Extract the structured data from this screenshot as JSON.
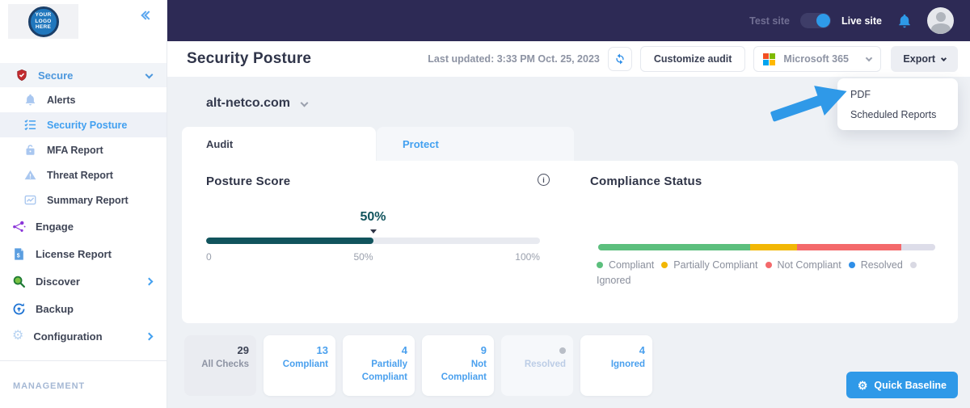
{
  "topbar": {
    "test_site": "Test site",
    "live_site": "Live site"
  },
  "sidebar": {
    "logo_lines": [
      "YOUR",
      "LOGO",
      "HERE"
    ],
    "secure_label": "Secure",
    "secure_items": [
      {
        "label": "Alerts",
        "icon": "bell-icon"
      },
      {
        "label": "Security Posture",
        "icon": "checklist-icon",
        "active": true
      },
      {
        "label": "MFA Report",
        "icon": "lock-icon"
      },
      {
        "label": "Threat Report",
        "icon": "warning-icon"
      },
      {
        "label": "Summary Report",
        "icon": "chart-icon"
      }
    ],
    "items": [
      {
        "label": "Engage",
        "icon": "network-icon"
      },
      {
        "label": "License Report",
        "icon": "invoice-icon"
      },
      {
        "label": "Discover",
        "icon": "magnifier-icon",
        "chevron": true
      },
      {
        "label": "Backup",
        "icon": "sync-shield-icon"
      },
      {
        "label": "Configuration",
        "icon": "gear-icon",
        "chevron": true
      }
    ],
    "section_label": "MANAGEMENT"
  },
  "header": {
    "title": "Security Posture",
    "last_updated": "Last updated: 3:33 PM Oct. 25, 2023",
    "customize_button": "Customize audit",
    "platform_select": "Microsoft 365",
    "export_button": "Export",
    "export_menu": [
      "PDF",
      "Scheduled Reports"
    ],
    "ms_colors": {
      "tl": "#f25022",
      "tr": "#7fba00",
      "bl": "#00a4ef",
      "br": "#ffb900"
    }
  },
  "main": {
    "org_name": "alt-netco.com",
    "tabs": [
      {
        "label": "Audit",
        "active": true
      },
      {
        "label": "Protect"
      }
    ],
    "posture": {
      "title": "Posture Score",
      "score": 50,
      "score_label": "50%",
      "ticks": [
        "0",
        "50%",
        "100%"
      ],
      "bar_color": "#11545d"
    },
    "compliance": {
      "title": "Compliance Status",
      "segments": [
        {
          "name": "Compliant",
          "pct": 45,
          "color": "#5cbf7d"
        },
        {
          "name": "Partially Compliant",
          "pct": 14,
          "color": "#f2b705"
        },
        {
          "name": "Not Compliant",
          "pct": 31,
          "color": "#f4696b"
        },
        {
          "name": "Ignored",
          "pct": 10,
          "color": "#dddde9"
        }
      ],
      "legend": [
        {
          "label": "Compliant",
          "color": "#5cbf7d"
        },
        {
          "label": "Partially Compliant",
          "color": "#f2b705"
        },
        {
          "label": "Not Compliant",
          "color": "#f4696b"
        },
        {
          "label": "Resolved",
          "color": "#2e8fe8"
        },
        {
          "label": "Ignored",
          "color": "#d9d9e3"
        }
      ]
    },
    "cards": [
      {
        "value": "29",
        "label": "All Checks",
        "state": "selected"
      },
      {
        "value": "13",
        "label": "Compliant",
        "state": "normal"
      },
      {
        "value": "4",
        "label": "Partially Compliant",
        "state": "normal"
      },
      {
        "value": "9",
        "label": "Not Compliant",
        "state": "normal"
      },
      {
        "value": "",
        "label": "Resolved",
        "state": "disabled"
      },
      {
        "value": "4",
        "label": "Ignored",
        "state": "normal"
      }
    ],
    "quick_baseline": "Quick Baseline"
  }
}
